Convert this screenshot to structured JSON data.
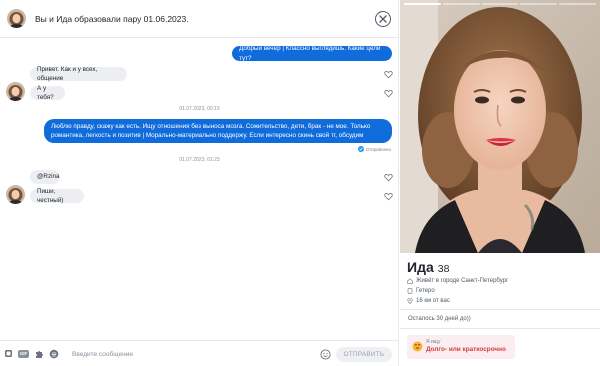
{
  "header": {
    "title": "Вы и Ида образовали пару 01.06.2023."
  },
  "messages": [
    {
      "direction": "out",
      "text": "Добрый вечер | Классно выглядишь. Какие цели тут?"
    },
    {
      "direction": "in",
      "text": "Привет. Как и у всех, общение"
    },
    {
      "direction": "in",
      "text": "А у тебя?"
    },
    {
      "timestamp": "01.07.2023, 00:19"
    },
    {
      "direction": "out",
      "text_lines": [
        "Люблю правду, скажу как есть. Ищу отношения без выноса мозга. Сожительство, дети, брак - не мое. Только",
        "романтика, легкость и позитив | Морально-материально поддержу. Если интересно скинь свой тг, обсудим"
      ]
    },
    {
      "status": "Отправлено"
    },
    {
      "timestamp": "01.07.2023, 01:23"
    },
    {
      "direction": "in",
      "text": "@Rzina"
    },
    {
      "direction": "in",
      "text": "Пиши, честный)"
    }
  ],
  "composer": {
    "placeholder": "Введите сообщение",
    "send_label": "ОТПРАВИТЬ",
    "gif_label": "GIF"
  },
  "profile": {
    "name": "Ида",
    "age": "38",
    "city": "Живёт в городе Санкт-Петербург",
    "orientation": "Гетеро",
    "distance": "16 км от вас",
    "time_left": "Осталось 30 дней до))",
    "looking_for_label": "Я ищу",
    "looking_for_value": "Долго- или краткосрочно"
  },
  "colors": {
    "outgoing_bubble": "#106bdb",
    "incoming_bubble": "#eceef2",
    "accent_red": "#d93a3a",
    "looking_card_bg": "#fbeef0"
  },
  "icons": {
    "close": "close-circle-icon",
    "like": "heart-outline-icon",
    "sent": "check-circle-icon",
    "home": "home-icon",
    "gender": "gender-icon",
    "location": "location-pin-icon",
    "looking": "heart-eyes-emoji-icon"
  }
}
